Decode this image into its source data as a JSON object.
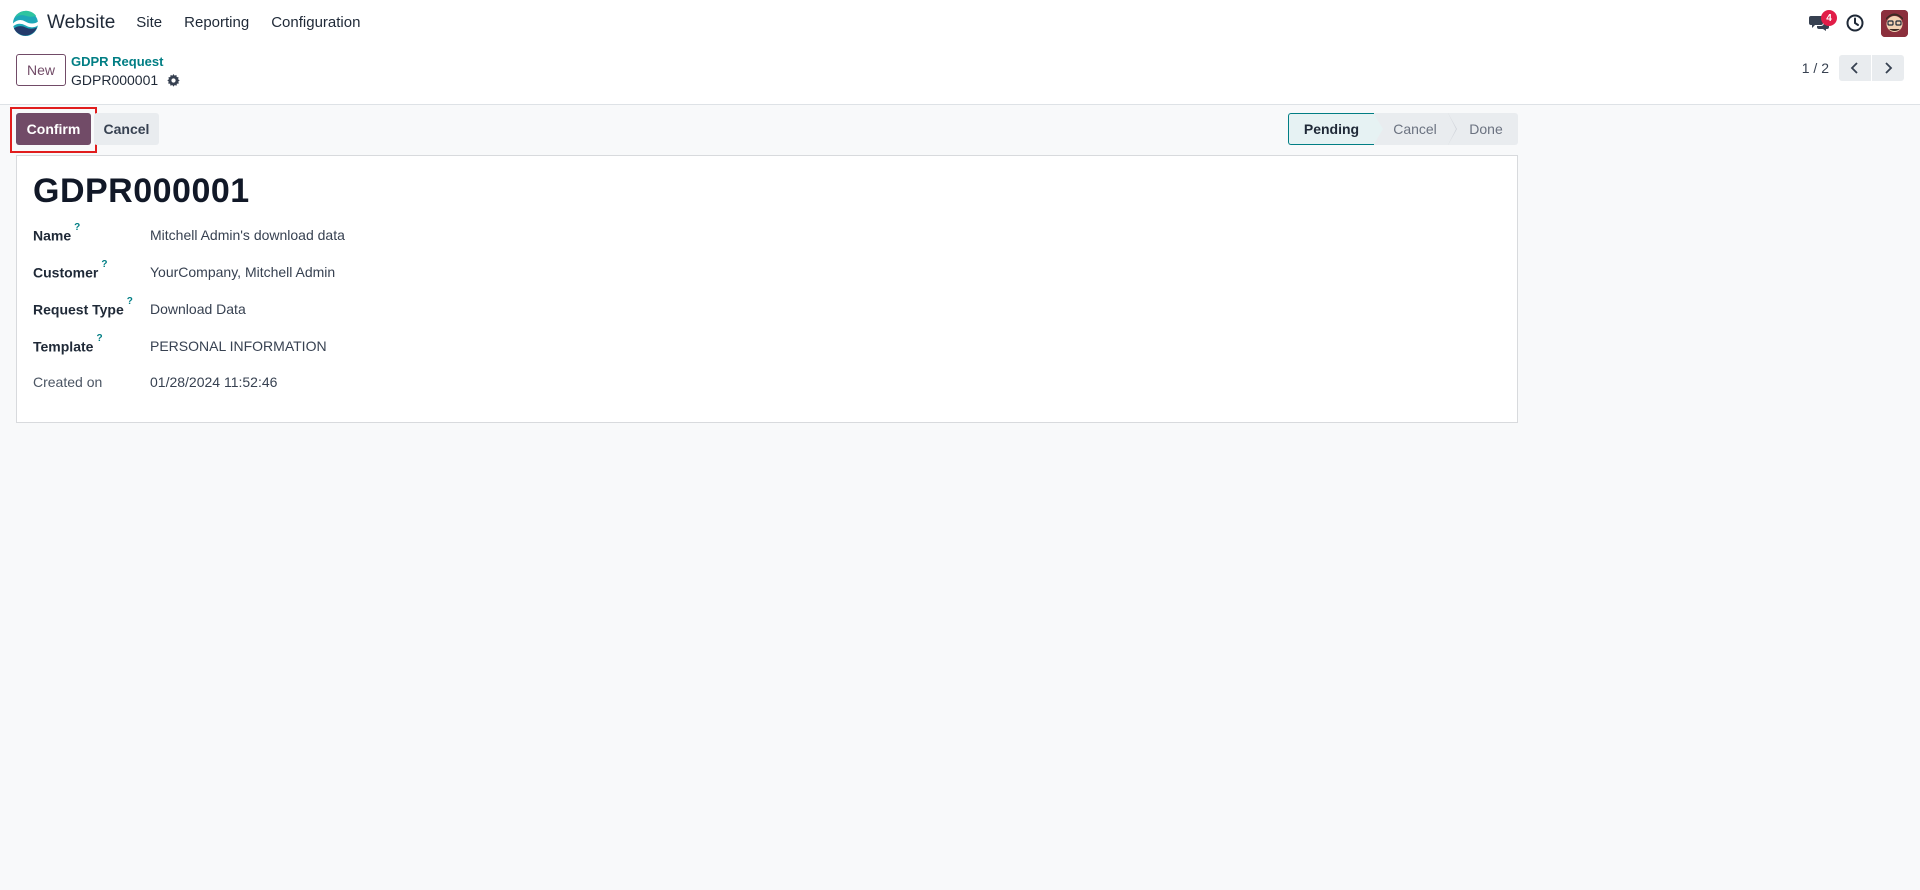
{
  "navbar": {
    "app_name": "Website",
    "menu": [
      "Site",
      "Reporting",
      "Configuration"
    ],
    "messages_badge": "4"
  },
  "control_panel": {
    "new_label": "New",
    "breadcrumb_parent": "GDPR Request",
    "breadcrumb_current": "GDPR000001",
    "pager_value": "1 / 2"
  },
  "statusbar": {
    "confirm_label": "Confirm",
    "cancel_label": "Cancel",
    "stages": [
      "Pending",
      "Cancel",
      "Done"
    ],
    "active_stage": "Pending"
  },
  "form": {
    "title": "GDPR000001",
    "fields": [
      {
        "label": "Name",
        "help": "?",
        "value": "Mitchell Admin's download data"
      },
      {
        "label": "Customer",
        "help": "?",
        "value": "YourCompany, Mitchell Admin"
      },
      {
        "label": "Request Type",
        "help": "?",
        "value": "Download Data"
      },
      {
        "label": "Template",
        "help": "?",
        "value": "PERSONAL INFORMATION"
      },
      {
        "label": "Created on",
        "value": "01/28/2024 11:52:46"
      }
    ]
  },
  "colors": {
    "brand_primary": "#714b67",
    "link_teal": "#017e84",
    "badge_red": "#e11d48",
    "highlight_red": "#e11d1d"
  },
  "icons": {
    "app_logo": "website-logo-icon",
    "messages": "chat-bubbles-icon",
    "activities": "clock-icon",
    "settings": "gear-icon",
    "pager_prev": "chevron-left-icon",
    "pager_next": "chevron-right-icon"
  }
}
